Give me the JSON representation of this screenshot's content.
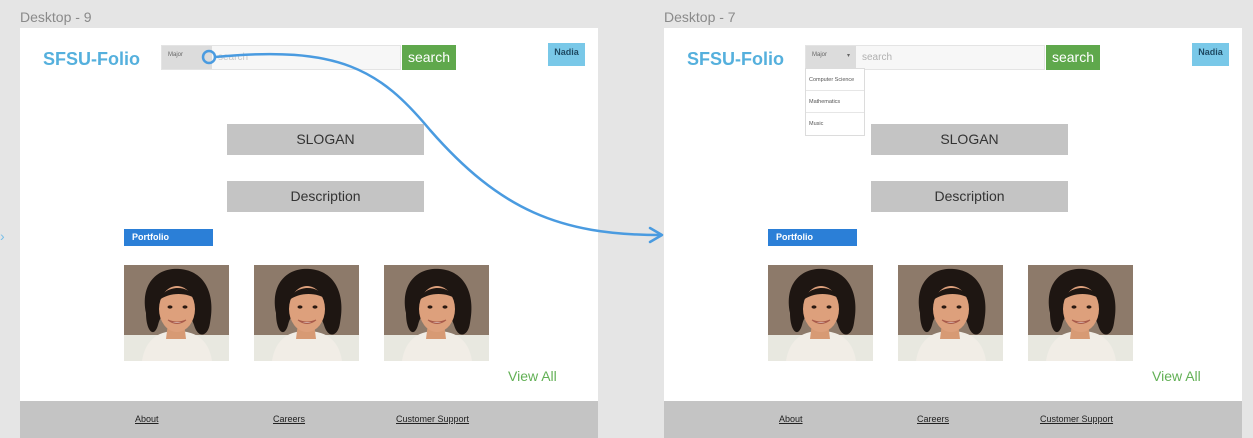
{
  "frames": [
    {
      "label": "Desktop - 9",
      "logo": "SFSU-Folio",
      "major_select": "Major",
      "search_placeholder": "search",
      "search_button": "search",
      "user_button": "Nadia",
      "slogan": "SLOGAN",
      "description": "Description",
      "portfolio_tag": "Portfolio",
      "view_all": "View All",
      "footer_links": [
        "About",
        "Careers",
        "Customer Support"
      ]
    },
    {
      "label": "Desktop - 7",
      "logo": "SFSU-Folio",
      "major_select": "Major",
      "search_placeholder": "search",
      "search_button": "search",
      "user_button": "Nadia",
      "slogan": "SLOGAN",
      "description": "Description",
      "portfolio_tag": "Portfolio",
      "view_all": "View All",
      "footer_links": [
        "About",
        "Careers",
        "Customer Support"
      ],
      "dropdown_options": [
        "Computer Science",
        "Mathematics",
        "Music"
      ]
    }
  ],
  "prototype_link": {
    "from": "Desktop - 9",
    "to": "Desktop - 7",
    "trigger": "Major"
  },
  "colors": {
    "logo": "#55b0dd",
    "search_button": "#5fa84c",
    "user_button": "#79c8e8",
    "portfolio_tag": "#2b7fd7",
    "view_all": "#62b055",
    "placeholder_box": "#c4c4c4",
    "prototype_arrow": "#4a9be0"
  }
}
